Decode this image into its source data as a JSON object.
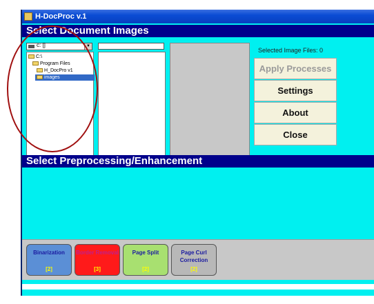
{
  "window": {
    "title": "H-DocProc v.1"
  },
  "select_images": {
    "header": "Select Document Images",
    "drive": "c: []",
    "tree": [
      "C:\\",
      "Program Files",
      "H_DocPro v1",
      "images"
    ],
    "file_filter": "",
    "selected_count": "Selected Image Files: 0"
  },
  "buttons": {
    "apply": "Apply Processes",
    "settings": "Settings",
    "about": "About",
    "close": "Close"
  },
  "preprocessing": {
    "header": "Select Preprocessing/Enhancement",
    "tools": [
      {
        "label": "Binarization",
        "count": "[2]",
        "color": "#5b8fd6",
        "text_color": "#1a1aa0"
      },
      {
        "label": "Border Removal",
        "count": "[3]",
        "color": "#ff1a1a",
        "text_color": "#c0208a"
      },
      {
        "label": "Page Split",
        "count": "[2]",
        "color": "#a8e070",
        "text_color": "#1a1aa0"
      },
      {
        "label": "Page Curl Correction",
        "count": "[2]",
        "color": "#b8b8b8",
        "text_color": "#1a1aa0"
      }
    ]
  },
  "colors": {
    "window_bg": "#00f0f0",
    "header_bg": "#00008b",
    "annotation": "#a01010"
  }
}
